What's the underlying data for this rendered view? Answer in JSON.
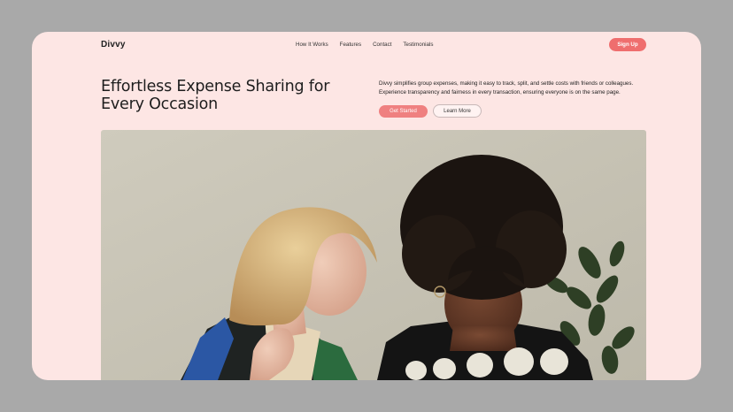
{
  "brand": {
    "name": "Divvy"
  },
  "nav": {
    "links": [
      "How It Works",
      "Features",
      "Contact",
      "Testimonials"
    ],
    "signup_label": "Sign Up"
  },
  "hero": {
    "headline": "Effortless Expense Sharing for Every Occasion",
    "description": "Divvy simplifies group expenses, making it easy to track, split, and settle costs with friends or colleagues. Experience transparency and fairness in every transaction, ensuring everyone is on the same page.",
    "primary_cta": "Get Started",
    "secondary_cta": "Learn More",
    "image_subject": "photo of two women looking down together"
  },
  "colors": {
    "page_bg": "#fde6e4",
    "outer_bg": "#a9a9a9",
    "accent": "#ef6e6e",
    "text": "#1d1d1d"
  }
}
